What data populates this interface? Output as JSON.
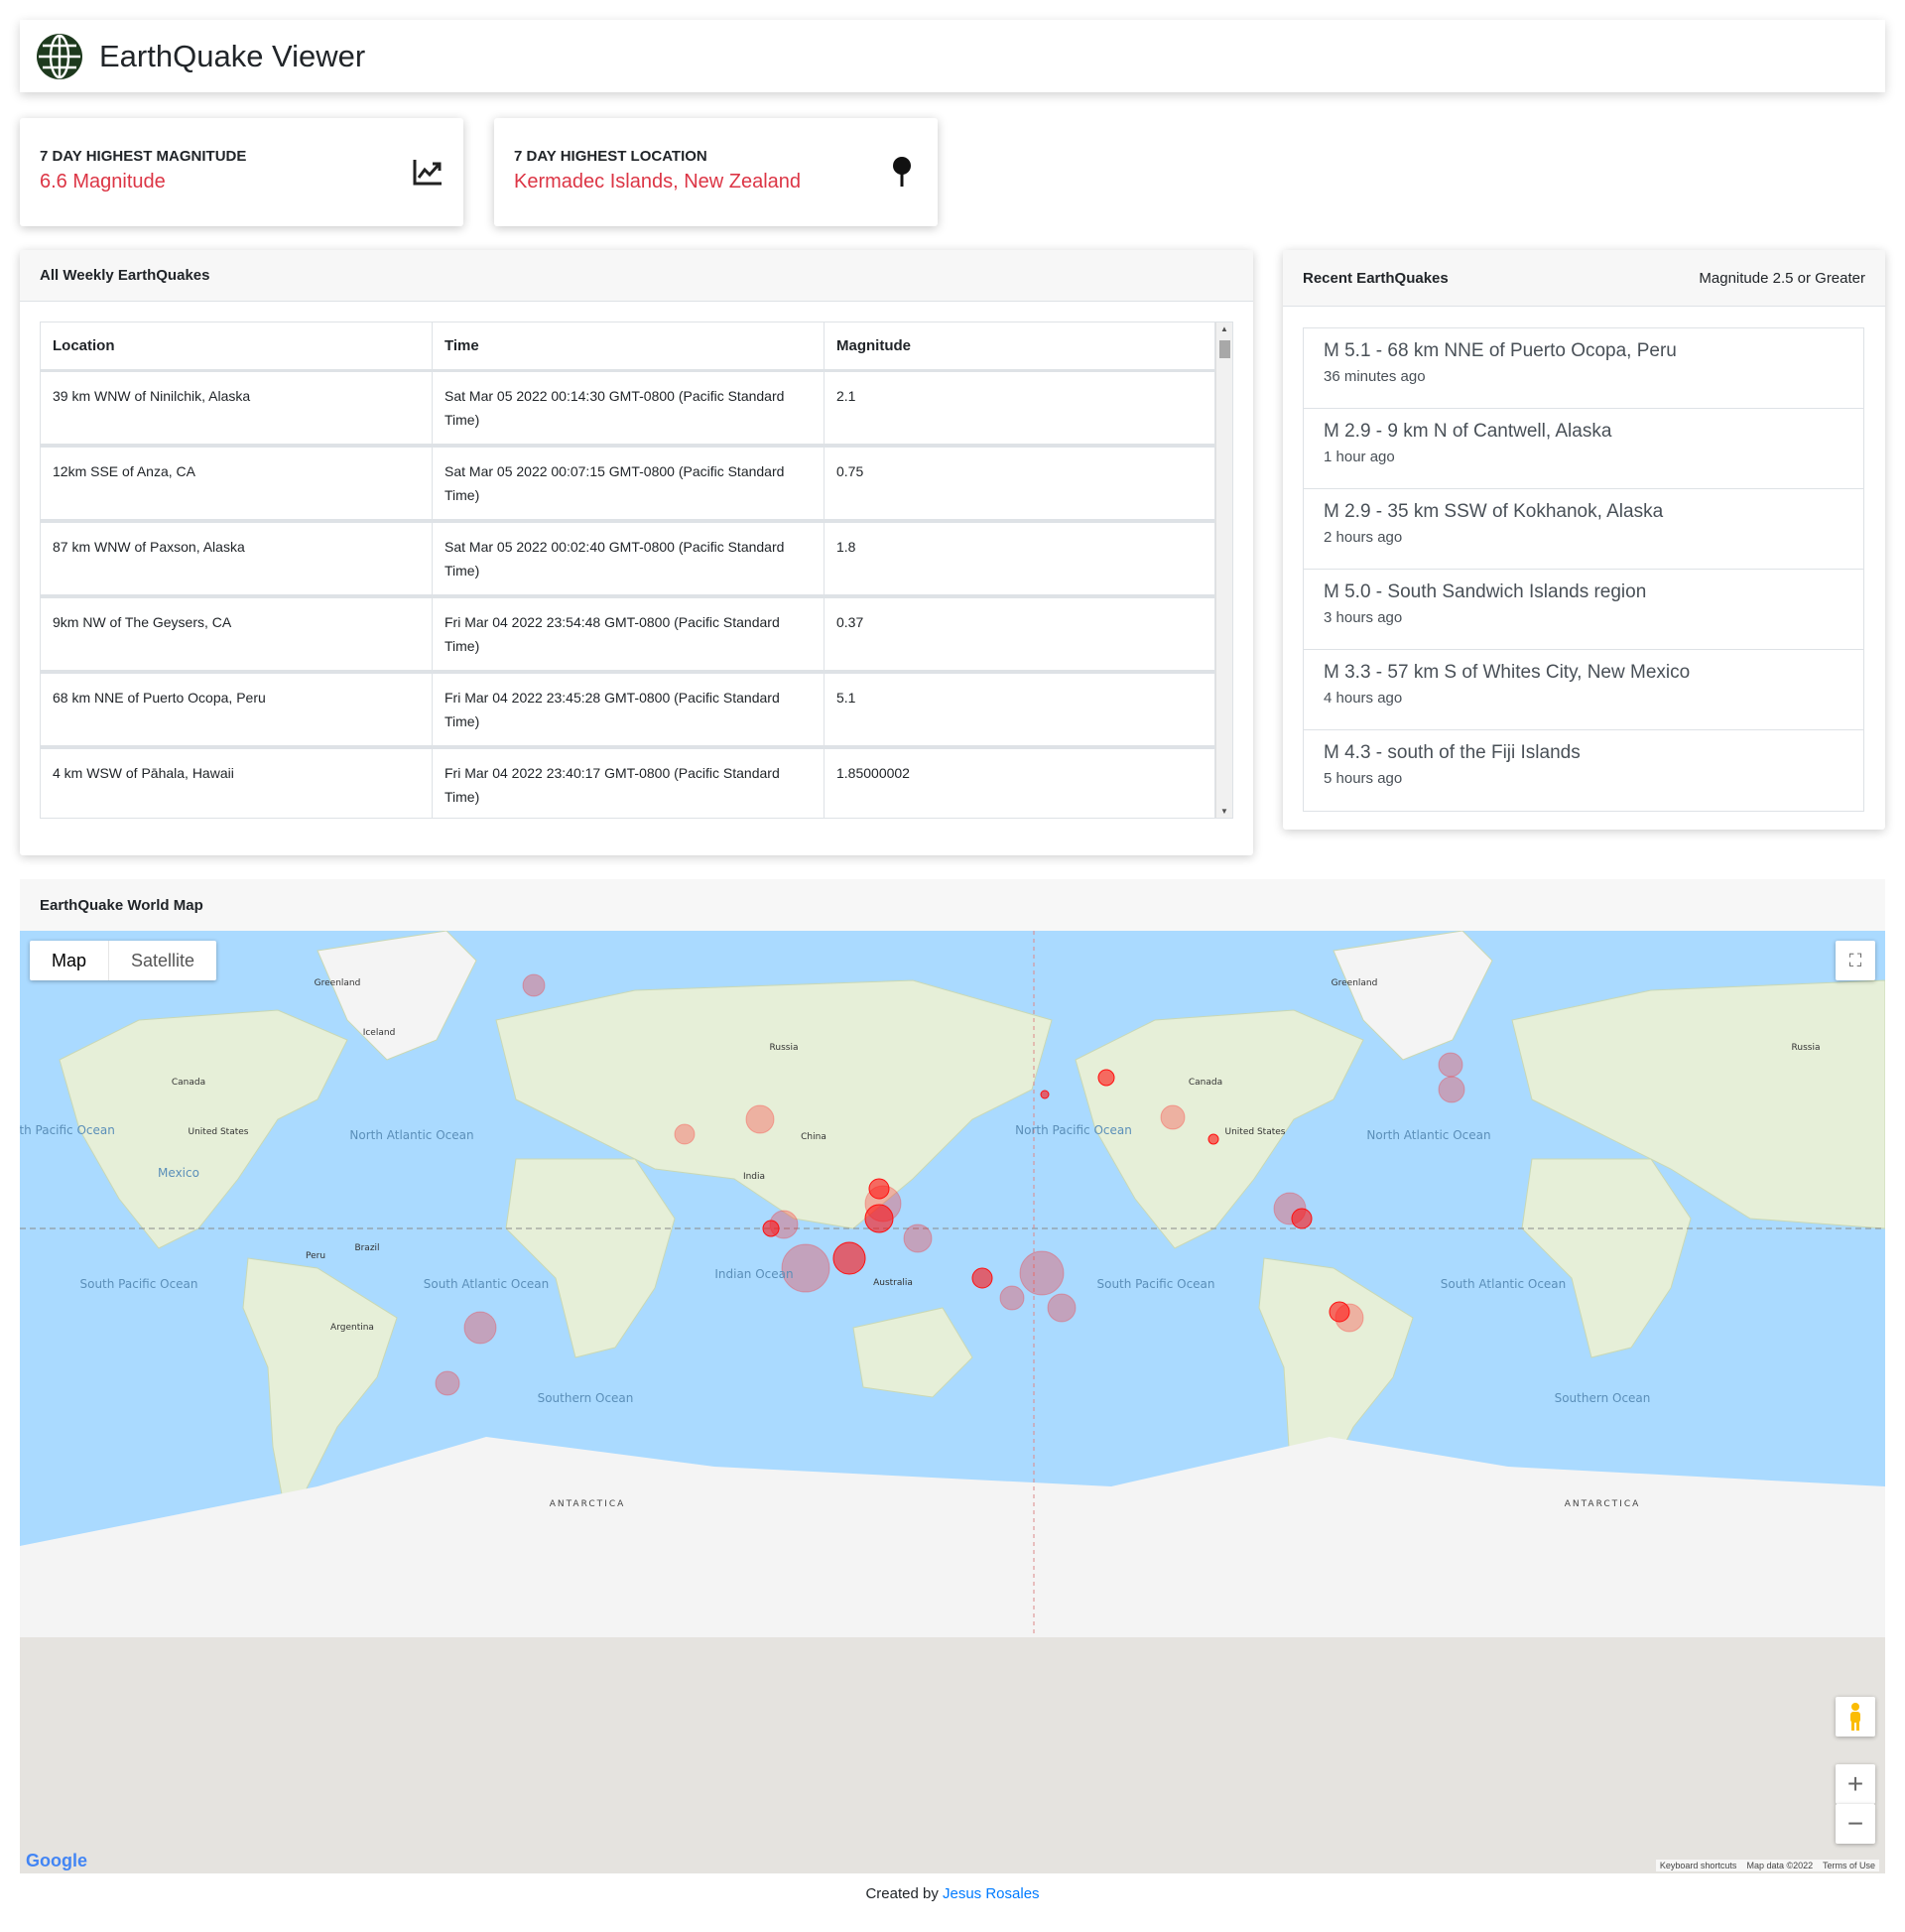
{
  "app": {
    "title": "EarthQuake Viewer"
  },
  "stats": [
    {
      "label": "7 DAY HIGHEST MAGNITUDE",
      "value": "6.6 Magnitude",
      "icon": "chart-line-icon"
    },
    {
      "label": "7 DAY HIGHEST LOCATION",
      "value": "Kermadec Islands, New Zealand",
      "icon": "map-pin-icon"
    }
  ],
  "weekly": {
    "title": "All Weekly EarthQuakes",
    "columns": [
      "Location",
      "Time",
      "Magnitude"
    ],
    "rows": [
      [
        "39 km WNW of Ninilchik, Alaska",
        "Sat Mar 05 2022 00:14:30 GMT-0800 (Pacific Standard Time)",
        "2.1"
      ],
      [
        "12km SSE of Anza, CA",
        "Sat Mar 05 2022 00:07:15 GMT-0800 (Pacific Standard Time)",
        "0.75"
      ],
      [
        "87 km WNW of Paxson, Alaska",
        "Sat Mar 05 2022 00:02:40 GMT-0800 (Pacific Standard Time)",
        "1.8"
      ],
      [
        "9km NW of The Geysers, CA",
        "Fri Mar 04 2022 23:54:48 GMT-0800 (Pacific Standard Time)",
        "0.37"
      ],
      [
        "68 km NNE of Puerto Ocopa, Peru",
        "Fri Mar 04 2022 23:45:28 GMT-0800 (Pacific Standard Time)",
        "5.1"
      ],
      [
        "4 km WSW of Pāhala, Hawaii",
        "Fri Mar 04 2022 23:40:17 GMT-0800 (Pacific Standard Time)",
        "1.85000002"
      ]
    ]
  },
  "recent": {
    "title": "Recent EarthQuakes",
    "subtitle": "Magnitude 2.5 or Greater",
    "items": [
      {
        "title": "M 5.1 - 68 km NNE of Puerto Ocopa, Peru",
        "ago": "36 minutes ago"
      },
      {
        "title": "M 2.9 - 9 km N of Cantwell, Alaska",
        "ago": "1 hour ago"
      },
      {
        "title": "M 2.9 - 35 km SSW of Kokhanok, Alaska",
        "ago": "2 hours ago"
      },
      {
        "title": "M 5.0 - South Sandwich Islands region",
        "ago": "3 hours ago"
      },
      {
        "title": "M 3.3 - 57 km S of Whites City, New Mexico",
        "ago": "4 hours ago"
      },
      {
        "title": "M 4.3 - south of the Fiji Islands",
        "ago": "5 hours ago"
      }
    ]
  },
  "map": {
    "title": "EarthQuake World Map",
    "type_buttons": [
      "Map",
      "Satellite"
    ],
    "active_type": "Map",
    "labels": {
      "greenland": "Greenland",
      "iceland": "Iceland",
      "canada": "Canada",
      "us": "United States",
      "mexico": "Mexico",
      "brazil": "Brazil",
      "peru": "Peru",
      "argentina": "Argentina",
      "russia": "Russia",
      "china": "China",
      "india": "India",
      "australia": "Australia",
      "antarctica": "ANTARCTICA",
      "npo": "North Pacific Ocean",
      "nao": "North Atlantic Ocean",
      "spo": "South Pacific Ocean",
      "sao": "South Atlantic Ocean",
      "io": "Indian Ocean",
      "so": "Southern Ocean"
    },
    "attribution": {
      "logo": "Google",
      "shortcuts": "Keyboard shortcuts",
      "data": "Map data ©2022",
      "terms": "Terms of Use"
    },
    "colors": {
      "ocean": "#aadaff",
      "land": "#e6efd8",
      "ice": "#f4f4f4",
      "quake": "#ff2020"
    }
  },
  "footer": {
    "prefix": "Created by",
    "author": "Jesus Rosales"
  }
}
